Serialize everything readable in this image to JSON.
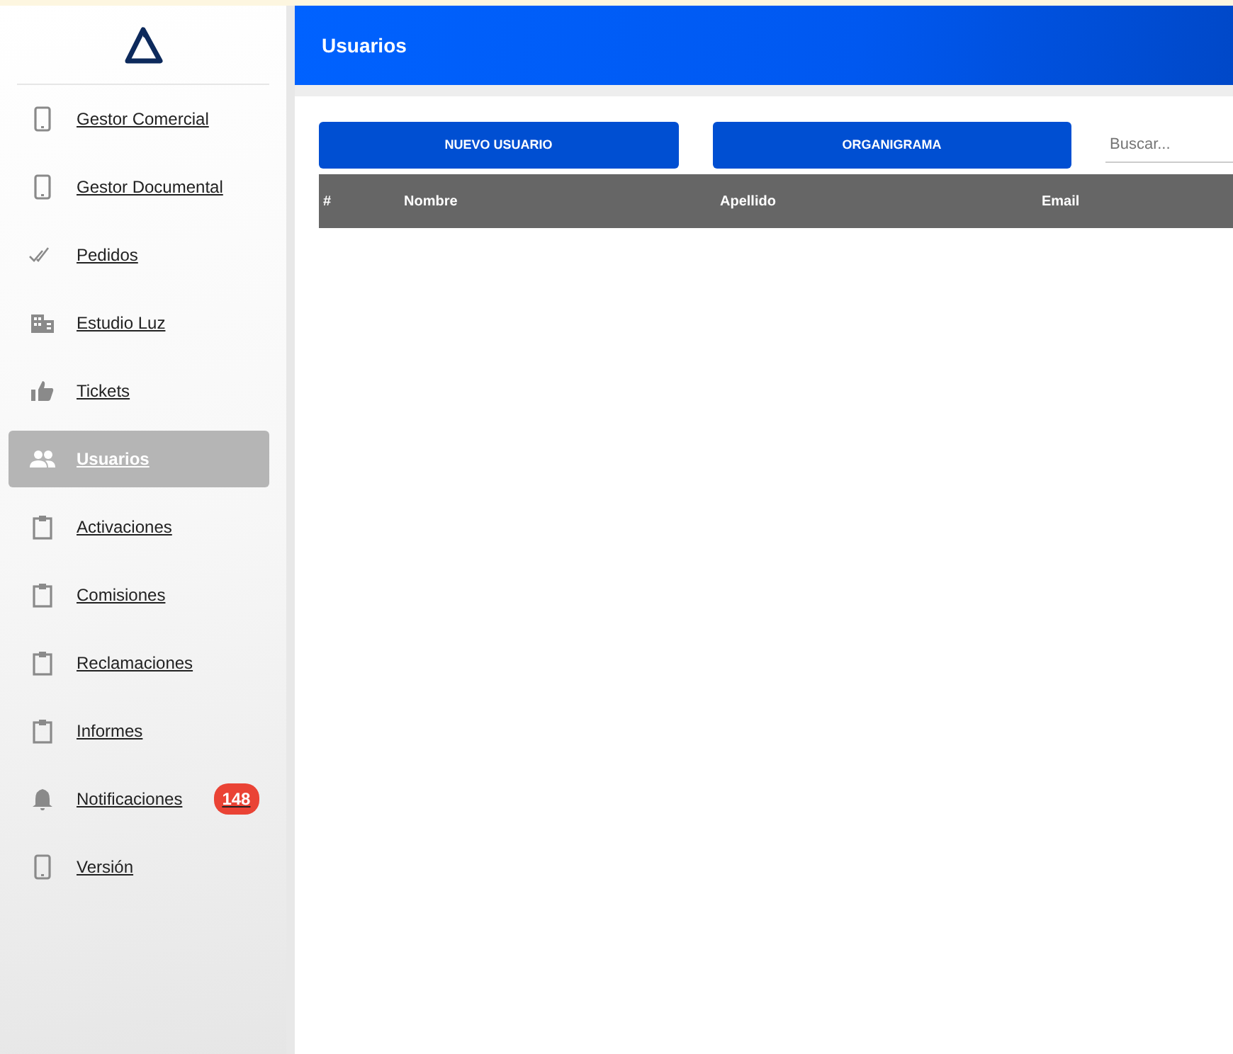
{
  "sidebar": {
    "items": [
      {
        "label": "Gestor Comercial",
        "selected": false
      },
      {
        "label": "Gestor Documental",
        "selected": false
      },
      {
        "label": "Pedidos",
        "selected": false
      },
      {
        "label": "Estudio Luz",
        "selected": false
      },
      {
        "label": "Tickets",
        "selected": false
      },
      {
        "label": "Usuarios",
        "selected": true
      },
      {
        "label": "Activaciones",
        "selected": false
      },
      {
        "label": "Comisiones",
        "selected": false
      },
      {
        "label": "Reclamaciones",
        "selected": false
      },
      {
        "label": "Informes",
        "selected": false
      },
      {
        "label": "Notificaciones",
        "selected": false,
        "badge": "148"
      },
      {
        "label": "Versión",
        "selected": false
      }
    ]
  },
  "header": {
    "title": "Usuarios"
  },
  "toolbar": {
    "buttons": [
      "NUEVO USUARIO",
      "ORGANIGRAMA"
    ],
    "search": {
      "placeholder": "Buscar..."
    }
  },
  "table": {
    "columns": [
      "#",
      "Nombre",
      "Apellido",
      "Email"
    ]
  }
}
